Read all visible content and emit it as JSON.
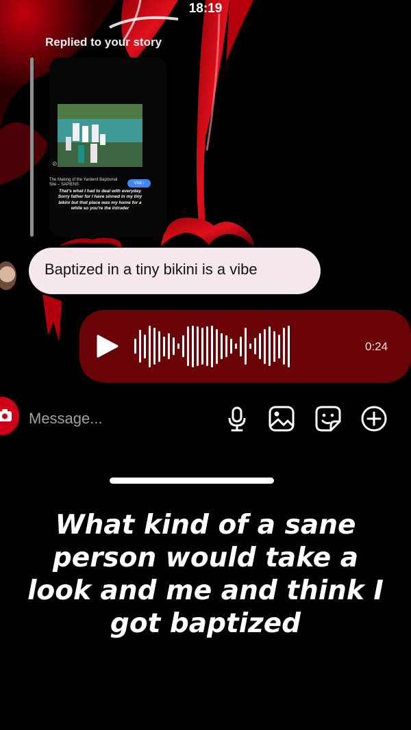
{
  "status_bar": {
    "time": "18:19"
  },
  "reply": {
    "label": "Replied to your story"
  },
  "story": {
    "site_text": "The Making of the Yardenit Baptismal Site – SAPIENS",
    "visit_label": "Visit ›",
    "caption": "That's what I had to deal with everyday Sorry father for I have sinned in my tiny bikini but that place was my home for a while so you're the intruder"
  },
  "messages": {
    "text_bubble": "Baptized in a tiny bikini is a vibe",
    "voice_duration": "0:24",
    "waveform_levels": [
      0.35,
      0.75,
      0.55,
      0.95,
      0.85,
      0.7,
      0.45,
      0.6,
      0.4,
      0.12,
      0.5,
      0.9,
      0.95,
      0.9,
      0.85,
      0.9,
      0.95,
      0.8,
      0.6,
      0.5,
      0.35,
      0.12,
      0.45,
      0.85,
      0.12,
      0.38,
      0.6,
      0.8,
      0.9,
      0.7,
      0.55,
      0.85,
      0.95
    ]
  },
  "composer": {
    "placeholder": "Message..."
  },
  "icons": {
    "camera": "camera-icon",
    "mic": "microphone-icon",
    "gallery": "image-gallery-icon",
    "sticker": "sticker-icon",
    "add": "plus-circle-icon",
    "play": "play-icon"
  },
  "overlay_caption": "What kind of a sane person would take a look and me and think I got baptized",
  "colors": {
    "voice_bubble": "#6a0307",
    "text_bubble": "#f6e9ee",
    "camera_button": "#d0001a",
    "background": "#000000"
  }
}
